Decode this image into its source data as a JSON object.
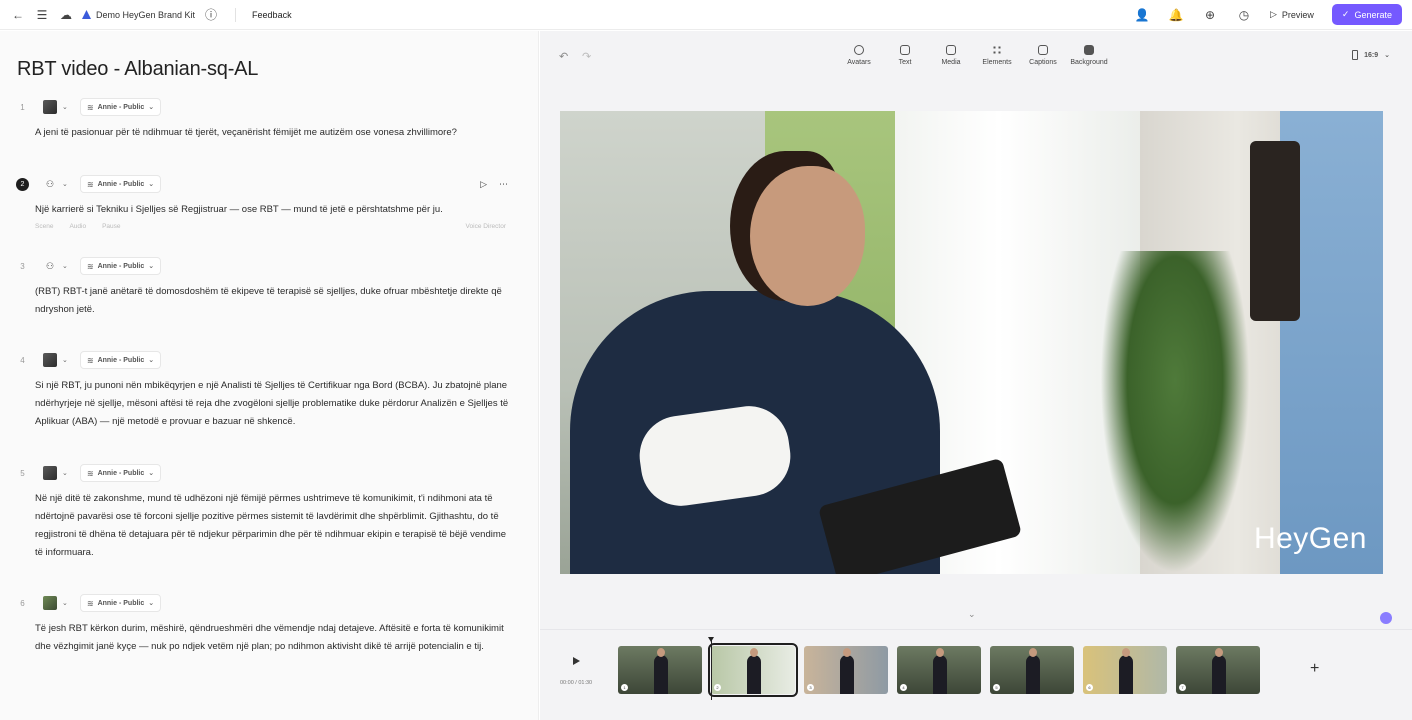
{
  "topbar": {
    "project": "Demo HeyGen Brand Kit",
    "feedback": "Feedback",
    "preview": "Preview",
    "generate": "Generate"
  },
  "doc": {
    "title": "RBT video - Albanian-sq-AL"
  },
  "scenes": [
    {
      "num": "1",
      "voice": "Annie - Public",
      "text": "A jeni të pasionuar për të ndihmuar të tjerët, veçanërisht fëmijët me autizëm ose vonesa zhvillimore?"
    },
    {
      "num": "2",
      "voice": "Annie - Public",
      "text": "Një karrierë si Tekniku i Sjelljes së Regjistruar — ose RBT — mund të jetë e përshtatshme për ju.",
      "tools": [
        "Scene",
        "Audio",
        "Pause"
      ],
      "tools_right": "Voice Director"
    },
    {
      "num": "3",
      "voice": "Annie - Public",
      "text": "(RBT) RBT-t janë anëtarë të domosdoshëm të ekipeve të terapisë së sjelljes, duke ofruar mbështetje direkte që ndryshon jetë."
    },
    {
      "num": "4",
      "voice": "Annie - Public",
      "text": "Si një RBT, ju punoni nën mbikëqyrjen e një Analisti të Sjelljes të Certifikuar nga Bord (BCBA). Ju zbatojnë plane ndërhyrjeje në sjellje, mësoni aftësi të reja dhe zvogëloni sjellje problematike duke përdorur Analizën e Sjelljes të Aplikuar (ABA) — një metodë e provuar e bazuar në shkencë."
    },
    {
      "num": "5",
      "voice": "Annie - Public",
      "text": "Në një ditë të zakonshme, mund të udhëzoni një fëmijë përmes ushtrimeve të komunikimit, t'i ndihmoni ata të ndërtojnë pavarësi ose të forconi sjellje pozitive përmes sistemit të lavdërimit dhe shpërblimit. Gjithashtu, do të regjistroni të dhëna të detajuara për të ndjekur përparimin dhe për të ndihmuar ekipin e terapisë të bëjë vendime të informuara."
    },
    {
      "num": "6",
      "voice": "Annie - Public",
      "text": "Të jesh RBT kërkon durim, mëshirë, qëndrueshmëri dhe vëmendje ndaj detajeve. Aftësitë e forta të komunikimit dhe vëzhgimit janë kyçe — nuk po ndjek vetëm një plan; po ndihmon aktivisht dikë të arrijë potencialin e tij."
    }
  ],
  "toolbar": {
    "items": [
      "Avatars",
      "Text",
      "Media",
      "Elements",
      "Captions",
      "Background"
    ],
    "ratio": "16:9"
  },
  "video": {
    "watermark": "HeyGen"
  },
  "timeline": {
    "time": "00:00 / 01:30",
    "scene_nums": [
      "1",
      "2",
      "3",
      "4",
      "5",
      "6",
      "7"
    ]
  }
}
